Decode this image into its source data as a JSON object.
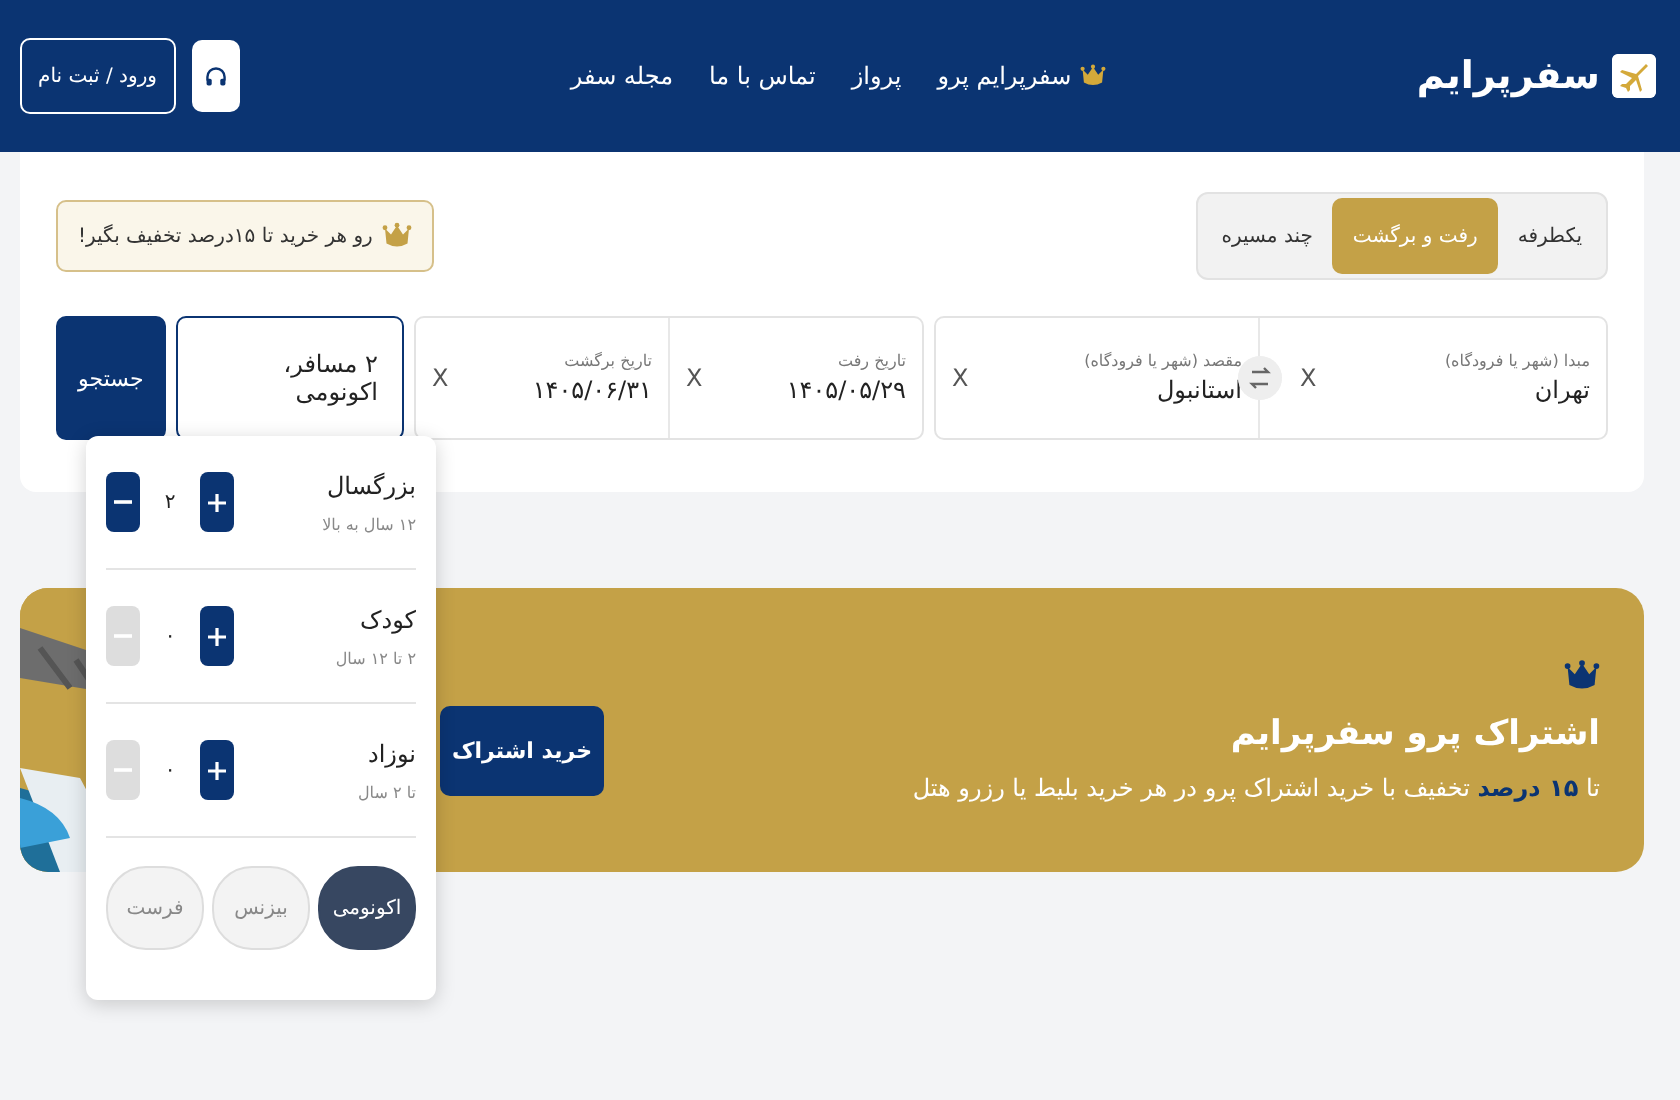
{
  "header": {
    "logo": "سفرپرایم",
    "nav": [
      {
        "label": "سفرپرایم پرو",
        "kind": "pro"
      },
      {
        "label": "پرواز",
        "kind": "link"
      },
      {
        "label": "تماس با ما",
        "kind": "link"
      },
      {
        "label": "مجله سفر",
        "kind": "link"
      }
    ],
    "login": "ورود / ثبت نام"
  },
  "search": {
    "trip_types": [
      {
        "label": "یکطرفه",
        "selected": false
      },
      {
        "label": "رفت و برگشت",
        "selected": true
      },
      {
        "label": "چند مسیره",
        "selected": false
      }
    ],
    "discount_badge": "رو هر خرید تا ۱۵درصد تخفیف بگیر!",
    "origin": {
      "label": "مبدا (شهر یا فرودگاه)",
      "value": "تهران",
      "clear": "X"
    },
    "destination": {
      "label": "مقصد (شهر یا فرودگاه)",
      "value": "استانبول",
      "clear": "X"
    },
    "departure": {
      "label": "تاریخ رفت",
      "value": "۱۴۰۵/۰۵/۲۹",
      "clear": "X"
    },
    "return": {
      "label": "تاریخ برگشت",
      "value": "۱۴۰۵/۰۶/۳۱",
      "clear": "X"
    },
    "passengers": {
      "value": "۲ مسافر، اکونومی",
      "focused": true
    },
    "search_button": "جستجو"
  },
  "passenger_panel": {
    "rows": [
      {
        "name": "بزرگسال",
        "note": "۱۲ سال به بالا",
        "count": "۲",
        "minus_disabled": false
      },
      {
        "name": "کودک",
        "note": "۲ تا ۱۲ سال",
        "count": "۰",
        "minus_disabled": true
      },
      {
        "name": "نوزاد",
        "note": "تا ۲ سال",
        "count": "۰",
        "minus_disabled": true
      }
    ],
    "classes": [
      {
        "label": "اکونومی",
        "selected": true
      },
      {
        "label": "بیزنس",
        "selected": false
      },
      {
        "label": "فرست",
        "selected": false
      }
    ]
  },
  "pro_banner": {
    "title": "اشتراک پرو سفرپرایم",
    "text": "تا **۱۵ درصد** تخفیف با خرید اشتراک پرو در هر خرید بلیط یا رزرو هتل",
    "button": "خرید اشتراک"
  }
}
